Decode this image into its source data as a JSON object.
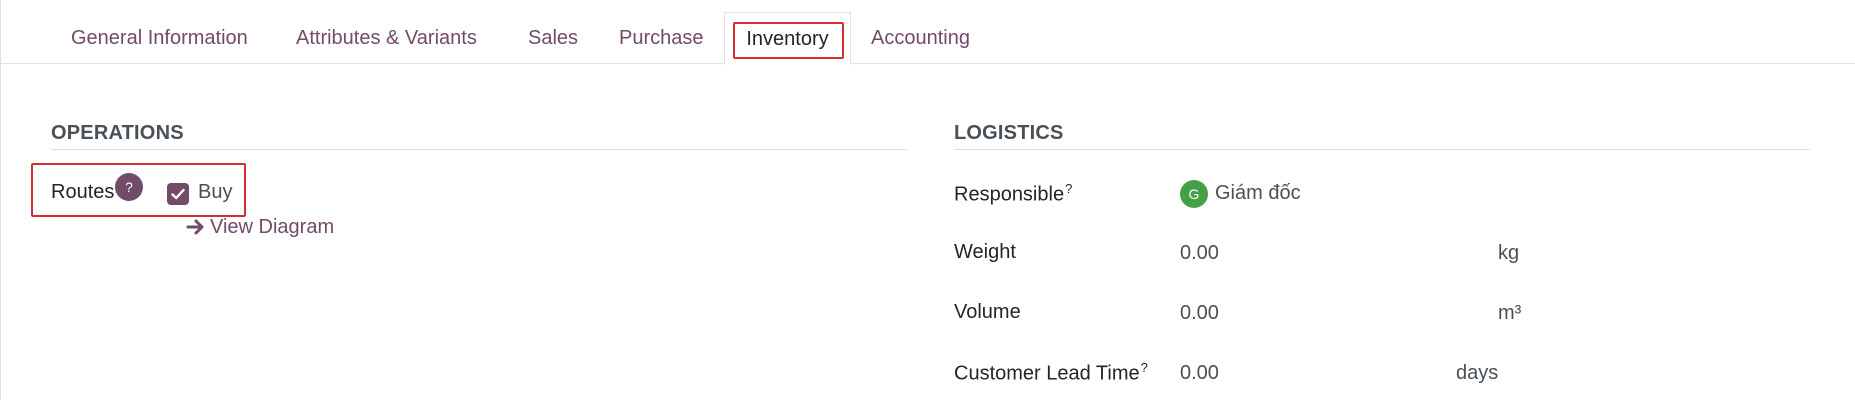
{
  "tabs": [
    {
      "label": "General Information"
    },
    {
      "label": "Attributes & Variants"
    },
    {
      "label": "Sales"
    },
    {
      "label": "Purchase"
    },
    {
      "label": "Inventory",
      "active": true
    },
    {
      "label": "Accounting"
    }
  ],
  "operations": {
    "title": "OPERATIONS",
    "routes_label": "Routes",
    "help_symbol": "?",
    "route_option": {
      "label": "Buy",
      "checked": true
    },
    "view_diagram_label": "View Diagram"
  },
  "logistics": {
    "title": "LOGISTICS",
    "responsible_label": "Responsible",
    "responsible_sup": "?",
    "responsible_avatar_letter": "G",
    "responsible_value": "Giám đốc",
    "weight_label": "Weight",
    "weight_value": "0.00",
    "weight_unit": "kg",
    "volume_label": "Volume",
    "volume_value": "0.00",
    "volume_unit": "m³",
    "lead_time_label": "Customer Lead Time",
    "lead_time_sup": "?",
    "lead_time_value": "0.00",
    "lead_time_unit": "days"
  },
  "colors": {
    "brand": "#714b67",
    "highlight": "#d32f2f",
    "avatar": "#43a047"
  }
}
